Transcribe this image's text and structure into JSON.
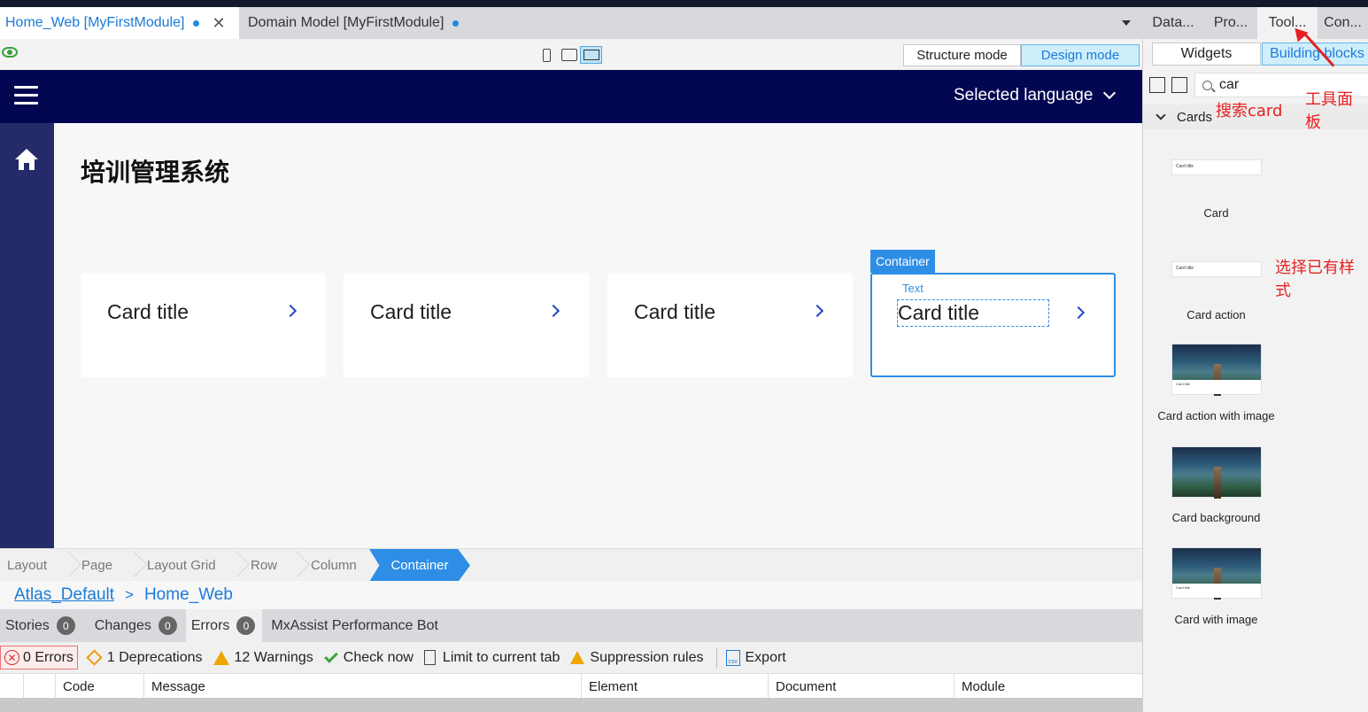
{
  "doc_tabs": {
    "active": "Home_Web [MyFirstModule]",
    "second": "Domain Model [MyFirstModule]"
  },
  "right_tabs": [
    "Data...",
    "Pro...",
    "Tool...",
    "Con..."
  ],
  "toolbar": {
    "structure_mode": "Structure mode",
    "design_mode": "Design mode"
  },
  "app": {
    "language": "Selected language",
    "page_title": "培训管理系统",
    "cards": [
      "Card title",
      "Card title",
      "Card title",
      "Card title"
    ],
    "container_label": "Container",
    "text_label": "Text"
  },
  "breadcrumb": [
    "Layout",
    "Page",
    "Layout Grid",
    "Row",
    "Column",
    "Container"
  ],
  "layout_path": {
    "layout": "Atlas_Default",
    "sep": ">",
    "page": "Home_Web"
  },
  "bottom_tabs": [
    {
      "label": "Stories",
      "count": "0"
    },
    {
      "label": "Changes",
      "count": "0"
    },
    {
      "label": "Errors",
      "count": "0"
    },
    {
      "label": "MxAssist Performance Bot"
    }
  ],
  "error_toolbar": {
    "errors": "0 Errors",
    "deprecations": "1 Deprecations",
    "warnings": "12 Warnings",
    "check_now": "Check now",
    "limit": "Limit to current tab",
    "suppression": "Suppression rules",
    "export": "Export"
  },
  "error_columns": [
    "Code",
    "Message",
    "Element",
    "Document",
    "Module"
  ],
  "toolbox": {
    "widgets_tab": "Widgets",
    "blocks_tab": "Building blocks",
    "search_value": "car",
    "group": "Cards",
    "items": [
      "Card",
      "Card action",
      "Card action with image",
      "Card background",
      "Card with image"
    ],
    "thumb_text": "Card title"
  },
  "annotations": {
    "toolbox": "工具面板",
    "search": "搜索card",
    "choose": "选择已有样式"
  },
  "colors": {
    "app_header": "#030752",
    "sidebar": "#252a68",
    "accent": "#2e8ee6",
    "annotation": "#e52222"
  }
}
